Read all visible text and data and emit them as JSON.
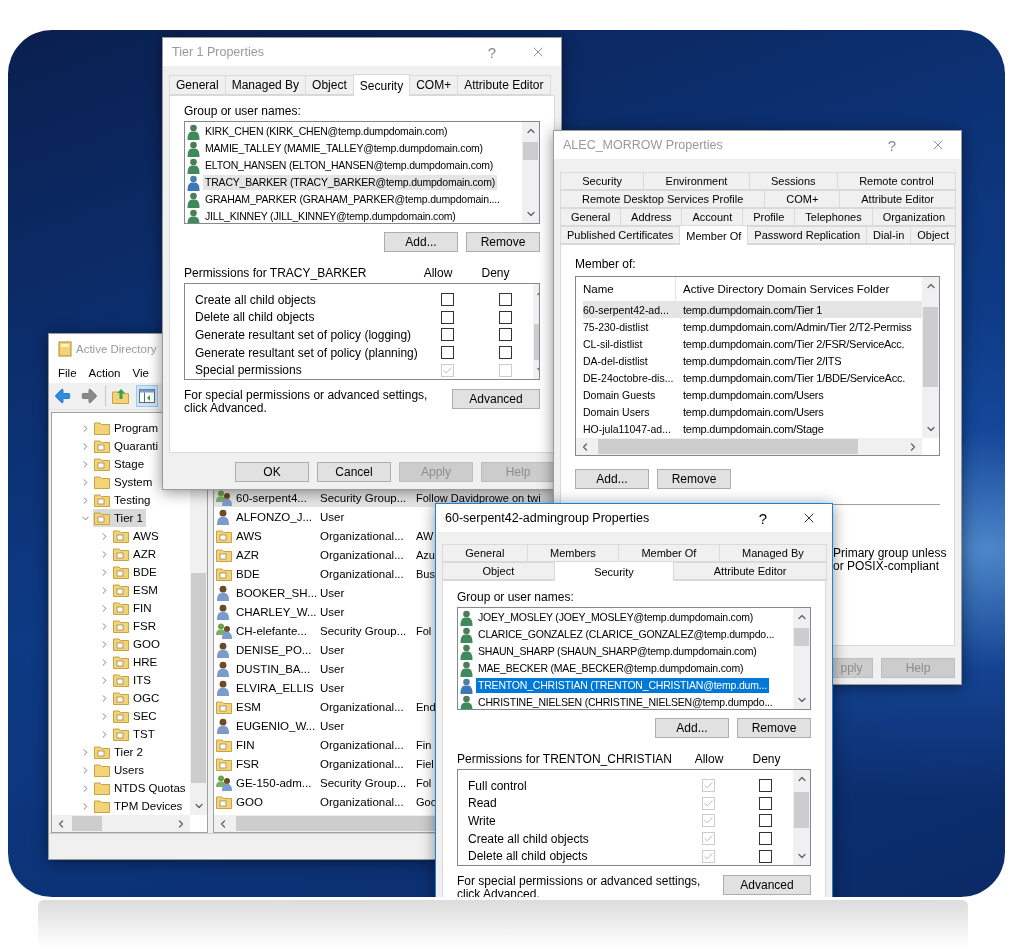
{
  "aduc_window": {
    "title": "Active Directory",
    "active": false,
    "menu": [
      "File",
      "Action",
      "Vie"
    ],
    "tree": [
      {
        "label": "Program",
        "kind": "container",
        "expanded": false,
        "selected": false
      },
      {
        "label": "Quaranti",
        "kind": "ou",
        "expanded": false,
        "selected": false
      },
      {
        "label": "Stage",
        "kind": "ou",
        "expanded": false,
        "selected": false
      },
      {
        "label": "System",
        "kind": "container",
        "expanded": false,
        "selected": false
      },
      {
        "label": "Testing",
        "kind": "ou",
        "expanded": false,
        "selected": false
      },
      {
        "label": "Tier 1",
        "kind": "ou",
        "expanded": true,
        "selected": true,
        "children": [
          {
            "label": "AWS",
            "kind": "ou",
            "expanded": false,
            "selected": false
          },
          {
            "label": "AZR",
            "kind": "ou",
            "expanded": false,
            "selected": false
          },
          {
            "label": "BDE",
            "kind": "ou",
            "expanded": false,
            "selected": false
          },
          {
            "label": "ESM",
            "kind": "ou",
            "expanded": false,
            "selected": false
          },
          {
            "label": "FIN",
            "kind": "ou",
            "expanded": false,
            "selected": false
          },
          {
            "label": "FSR",
            "kind": "ou",
            "expanded": false,
            "selected": false
          },
          {
            "label": "GOO",
            "kind": "ou",
            "expanded": false,
            "selected": false
          },
          {
            "label": "HRE",
            "kind": "ou",
            "expanded": false,
            "selected": false
          },
          {
            "label": "ITS",
            "kind": "ou",
            "expanded": false,
            "selected": false
          },
          {
            "label": "OGC",
            "kind": "ou",
            "expanded": false,
            "selected": false
          },
          {
            "label": "SEC",
            "kind": "ou",
            "expanded": false,
            "selected": false
          },
          {
            "label": "TST",
            "kind": "ou",
            "expanded": false,
            "selected": false
          }
        ]
      },
      {
        "label": "Tier 2",
        "kind": "ou",
        "expanded": false,
        "selected": false
      },
      {
        "label": "Users",
        "kind": "container",
        "expanded": false,
        "selected": false
      },
      {
        "label": "NTDS Quotas",
        "kind": "container",
        "expanded": false,
        "selected": false
      },
      {
        "label": "TPM Devices",
        "kind": "container",
        "expanded": false,
        "selected": false
      }
    ],
    "rows": [
      {
        "name": "60-serpent4...",
        "type": "Security Group...",
        "description": "Follow Davidprowe on twi",
        "kind": "group",
        "selected": true
      },
      {
        "name": "ALFONZO_J...",
        "type": "User",
        "kind": "user",
        "selected": false
      },
      {
        "name": "AWS",
        "type": "Organizational...",
        "description": "AW",
        "kind": "ou",
        "selected": false
      },
      {
        "name": "AZR",
        "type": "Organizational...",
        "description": "Azu",
        "kind": "ou",
        "selected": false
      },
      {
        "name": "BDE",
        "type": "Organizational...",
        "description": "Bus",
        "kind": "ou",
        "selected": false
      },
      {
        "name": "BOOKER_SH...",
        "type": "User",
        "kind": "user",
        "selected": false
      },
      {
        "name": "CHARLEY_W...",
        "type": "User",
        "kind": "user",
        "selected": false
      },
      {
        "name": "CH-elefante...",
        "type": "Security Group...",
        "description": "Fol",
        "kind": "group",
        "selected": false
      },
      {
        "name": "DENISE_PO...",
        "type": "User",
        "kind": "user",
        "selected": false
      },
      {
        "name": "DUSTIN_BA...",
        "type": "User",
        "kind": "user",
        "selected": false
      },
      {
        "name": "ELVIRA_ELLIS",
        "type": "User",
        "kind": "user",
        "selected": false
      },
      {
        "name": "ESM",
        "type": "Organizational...",
        "description": "End",
        "kind": "ou",
        "selected": false
      },
      {
        "name": "EUGENIO_W...",
        "type": "User",
        "kind": "user",
        "selected": false
      },
      {
        "name": "FIN",
        "type": "Organizational...",
        "description": "Fin",
        "kind": "ou",
        "selected": false
      },
      {
        "name": "FSR",
        "type": "Organizational...",
        "description": "Fiel",
        "kind": "ou",
        "selected": false
      },
      {
        "name": "GE-150-adm...",
        "type": "Security Group...",
        "description": "Fol",
        "kind": "group",
        "selected": false
      },
      {
        "name": "GOO",
        "type": "Organizational...",
        "description": "Goo",
        "kind": "ou",
        "selected": false
      }
    ]
  },
  "tier1_dialog": {
    "title": "Tier 1 Properties",
    "help_button": "?",
    "active": false,
    "tab_rows": [
      [
        {
          "label": "General",
          "selected": false
        },
        {
          "label": "Managed By",
          "selected": false
        },
        {
          "label": "Object",
          "selected": false
        },
        {
          "label": "Security",
          "selected": true
        },
        {
          "label": "COM+",
          "selected": false
        },
        {
          "label": "Attribute Editor",
          "selected": false
        }
      ]
    ],
    "names_label": "Group or user names:",
    "principals": [
      {
        "name": "KIRK_CHEN (KIRK_CHEN@temp.dumpdomain.com)",
        "selected": false
      },
      {
        "name": "MAMIE_TALLEY (MAMIE_TALLEY@temp.dumpdomain.com)",
        "selected": false
      },
      {
        "name": "ELTON_HANSEN (ELTON_HANSEN@temp.dumpdomain.com)",
        "selected": false
      },
      {
        "name": "TRACY_BARKER (TRACY_BARKER@temp.dumpdomain.com)",
        "selected": true
      },
      {
        "name": "GRAHAM_PARKER (GRAHAM_PARKER@temp.dumpdomain....",
        "selected": false
      },
      {
        "name": "JILL_KINNEY (JILL_KINNEY@temp.dumpdomain.com)",
        "selected": false
      }
    ],
    "add_button": "Add...",
    "remove_button": "Remove",
    "permissions_label": "Permissions for TRACY_BARKER",
    "allow_label": "Allow",
    "deny_label": "Deny",
    "permissions": [
      {
        "name": "Create all child objects",
        "allow": {
          "checked": false,
          "disabled": false
        },
        "deny": {
          "checked": false,
          "disabled": false
        }
      },
      {
        "name": "Delete all child objects",
        "allow": {
          "checked": false,
          "disabled": false
        },
        "deny": {
          "checked": false,
          "disabled": false
        }
      },
      {
        "name": "Generate resultant set of policy (logging)",
        "allow": {
          "checked": false,
          "disabled": false
        },
        "deny": {
          "checked": false,
          "disabled": false
        }
      },
      {
        "name": "Generate resultant set of policy (planning)",
        "allow": {
          "checked": false,
          "disabled": false
        },
        "deny": {
          "checked": false,
          "disabled": false
        }
      },
      {
        "name": "Special permissions",
        "allow": {
          "checked": true,
          "disabled": true
        },
        "deny": {
          "checked": false,
          "disabled": true
        }
      }
    ],
    "advanced_note": "For special permissions or advanced settings, click Advanced.",
    "advanced_button": "Advanced",
    "buttons": [
      {
        "label": "OK",
        "disabled": false
      },
      {
        "label": "Cancel",
        "disabled": false
      },
      {
        "label": "Apply",
        "disabled": true
      },
      {
        "label": "Help",
        "disabled": true
      }
    ]
  },
  "user_dialog": {
    "title": "ALEC_MORROW Properties",
    "help_button": "?",
    "active": false,
    "tab_rows": [
      [
        {
          "label": "Security",
          "selected": false
        },
        {
          "label": "Environment",
          "selected": false
        },
        {
          "label": "Sessions",
          "selected": false
        },
        {
          "label": "Remote control",
          "selected": false
        }
      ],
      [
        {
          "label": "Remote Desktop Services Profile",
          "selected": false
        },
        {
          "label": "COM+",
          "selected": false
        },
        {
          "label": "Attribute Editor",
          "selected": false
        }
      ],
      [
        {
          "label": "General",
          "selected": false
        },
        {
          "label": "Address",
          "selected": false
        },
        {
          "label": "Account",
          "selected": false
        },
        {
          "label": "Profile",
          "selected": false
        },
        {
          "label": "Telephones",
          "selected": false
        },
        {
          "label": "Organization",
          "selected": false
        }
      ],
      [
        {
          "label": "Published Certificates",
          "selected": false
        },
        {
          "label": "Member Of",
          "selected": true
        },
        {
          "label": "Password Replication",
          "selected": false
        },
        {
          "label": "Dial-in",
          "selected": false
        },
        {
          "label": "Object",
          "selected": false
        }
      ]
    ],
    "member_label": "Member of:",
    "columns": [
      "Name",
      "Active Directory Domain Services Folder"
    ],
    "rows": [
      {
        "name": "60-serpent42-ad...",
        "folder": "temp.dumpdomain.com/Tier 1",
        "selected": true
      },
      {
        "name": "75-230-distlist",
        "folder": "temp.dumpdomain.com/Admin/Tier 2/T2-Permiss",
        "selected": false
      },
      {
        "name": "CL-sil-distlist",
        "folder": "temp.dumpdomain.com/Tier 2/FSR/ServiceAcc.",
        "selected": false
      },
      {
        "name": "DA-del-distlist",
        "folder": "temp.dumpdomain.com/Tier 2/ITS",
        "selected": false
      },
      {
        "name": "DE-24octobre-dis...",
        "folder": "temp.dumpdomain.com/Tier 1/BDE/ServiceAcc.",
        "selected": false
      },
      {
        "name": "Domain Guests",
        "folder": "temp.dumpdomain.com/Users",
        "selected": false
      },
      {
        "name": "Domain Users",
        "folder": "temp.dumpdomain.com/Users",
        "selected": false
      },
      {
        "name": "HO-jula11047-ad...",
        "folder": "temp.dumpdomain.com/Stage",
        "selected": false
      }
    ],
    "add_button": "Add...",
    "remove_button": "Remove",
    "notes": [
      "Primary group unless",
      "or POSIX-compliant"
    ],
    "buttons": [
      {
        "label": "pply",
        "disabled": true
      },
      {
        "label": "Help",
        "disabled": true
      }
    ]
  },
  "group_dialog": {
    "title": "60-serpent42-admingroup Properties",
    "help_button": "?",
    "active": true,
    "tab_rows": [
      [
        {
          "label": "General",
          "selected": false
        },
        {
          "label": "Members",
          "selected": false
        },
        {
          "label": "Member Of",
          "selected": false
        },
        {
          "label": "Managed By",
          "selected": false
        }
      ],
      [
        {
          "label": "Object",
          "selected": false
        },
        {
          "label": "Security",
          "selected": true
        },
        {
          "label": "Attribute Editor",
          "selected": false
        }
      ]
    ],
    "names_label": "Group or user names:",
    "principals": [
      {
        "name": "JOEY_MOSLEY (JOEY_MOSLEY@temp.dumpdomain.com)",
        "selected": false
      },
      {
        "name": "CLARICE_GONZALEZ (CLARICE_GONZALEZ@temp.dumpdo...",
        "selected": false
      },
      {
        "name": "SHAUN_SHARP (SHAUN_SHARP@temp.dumpdomain.com)",
        "selected": false
      },
      {
        "name": "MAE_BECKER (MAE_BECKER@temp.dumpdomain.com)",
        "selected": false
      },
      {
        "name": "TRENTON_CHRISTIAN (TRENTON_CHRISTIAN@temp.dum...",
        "selected": true
      },
      {
        "name": "CHRISTINE_NIELSEN (CHRISTINE_NIELSEN@temp.dumpdo...",
        "selected": false
      }
    ],
    "add_button": "Add...",
    "remove_button": "Remove",
    "permissions_label": "Permissions for TRENTON_CHRISTIAN",
    "allow_label": "Allow",
    "deny_label": "Deny",
    "permissions": [
      {
        "name": "Full control",
        "allow": {
          "checked": true,
          "disabled": true
        },
        "deny": {
          "checked": false,
          "disabled": false
        }
      },
      {
        "name": "Read",
        "allow": {
          "checked": true,
          "disabled": true
        },
        "deny": {
          "checked": false,
          "disabled": false
        }
      },
      {
        "name": "Write",
        "allow": {
          "checked": true,
          "disabled": true
        },
        "deny": {
          "checked": false,
          "disabled": false
        }
      },
      {
        "name": "Create all child objects",
        "allow": {
          "checked": true,
          "disabled": true
        },
        "deny": {
          "checked": false,
          "disabled": false
        }
      },
      {
        "name": "Delete all child objects",
        "allow": {
          "checked": true,
          "disabled": true
        },
        "deny": {
          "checked": false,
          "disabled": false
        }
      }
    ],
    "advanced_note": "For special permissions or advanced settings, click Advanced.",
    "advanced_button": "Advanced"
  }
}
